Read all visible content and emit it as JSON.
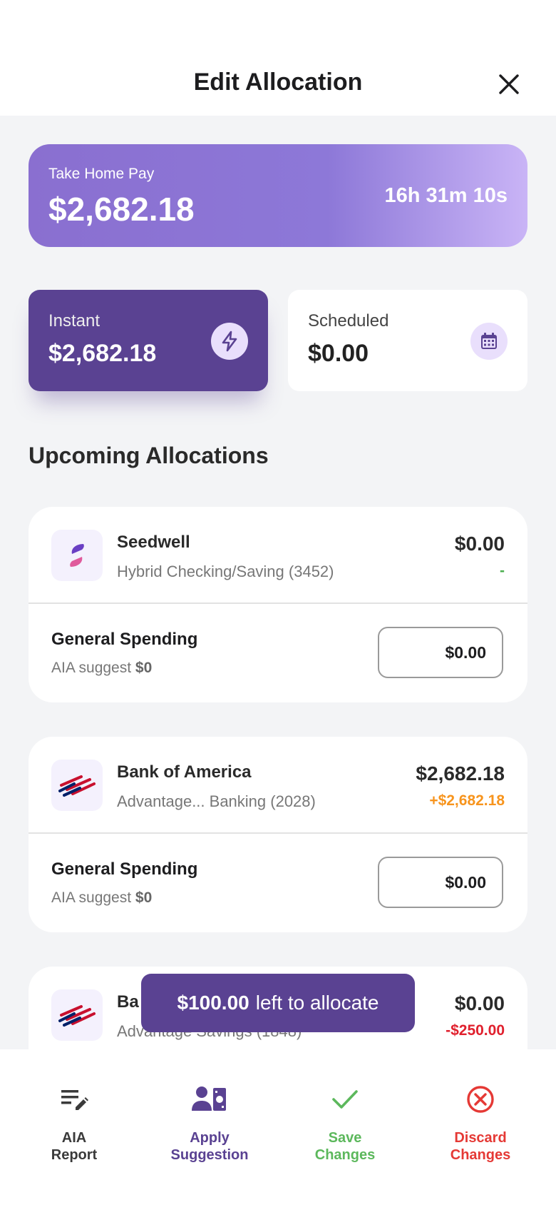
{
  "header": {
    "title": "Edit Allocation"
  },
  "take_home": {
    "label": "Take Home Pay",
    "amount": "$2,682.18",
    "timer": "16h 31m 10s"
  },
  "modes": {
    "instant": {
      "label": "Instant",
      "amount": "$2,682.18"
    },
    "scheduled": {
      "label": "Scheduled",
      "amount": "$0.00"
    }
  },
  "section_title": "Upcoming Allocations",
  "accounts": [
    {
      "name": "Seedwell",
      "sub": "Hybrid Checking/Saving (3452)",
      "balance": "$0.00",
      "delta": "-",
      "delta_color": "#4caf50",
      "category": "General Spending",
      "suggest_prefix": "AIA suggest",
      "suggest_value": "$0",
      "input_value": "$0.00"
    },
    {
      "name": "Bank of America",
      "sub": "Advantage... Banking (2028)",
      "balance": "$2,682.18",
      "delta": "+$2,682.18",
      "delta_color": "#f7941d",
      "category": "General Spending",
      "suggest_prefix": "AIA suggest",
      "suggest_value": "$0",
      "input_value": "$0.00"
    },
    {
      "name": "Ba",
      "sub": "Advantage Savings (1848)",
      "balance": "$0.00",
      "delta": "-$250.00",
      "delta_color": "#e0202d"
    }
  ],
  "toast": {
    "amount": "$100.00",
    "text": "left to allocate"
  },
  "toolbar": [
    {
      "label": "AIA\nReport",
      "color": "#3a3a3a",
      "icon": "report-edit-icon"
    },
    {
      "label": "Apply\nSuggestion",
      "color": "#5a4292",
      "icon": "apply-suggestion-icon"
    },
    {
      "label": "Save\nChanges",
      "color": "#5cb85c",
      "icon": "check-icon"
    },
    {
      "label": "Discard\nChanges",
      "color": "#e53935",
      "icon": "discard-icon"
    }
  ]
}
